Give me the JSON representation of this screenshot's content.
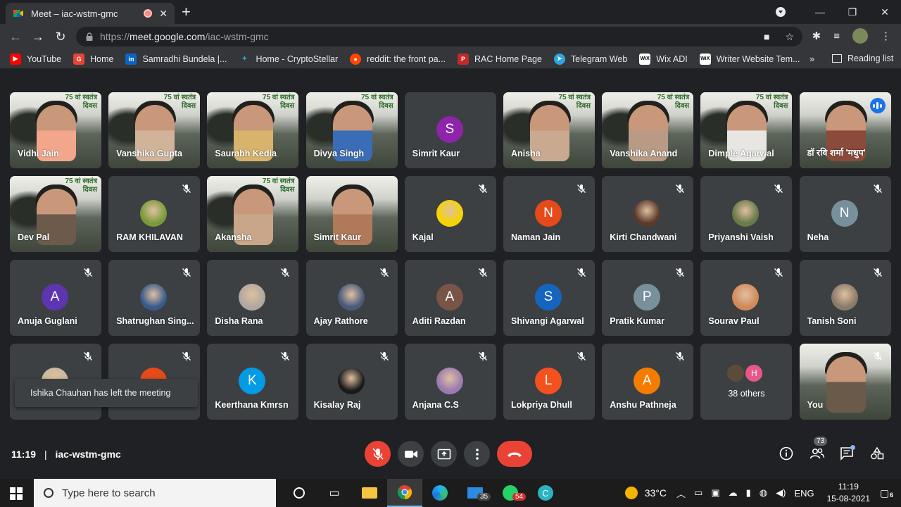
{
  "browser": {
    "tab_title": "Meet – iac-wstm-gmc",
    "url_prefix": "https://",
    "url_host": "meet.google.com",
    "url_path": "/iac-wstm-gmc"
  },
  "bookmarks": {
    "items": [
      {
        "label": "YouTube",
        "color": "#ff0000"
      },
      {
        "label": "Home",
        "color": "#ea4335"
      },
      {
        "label": "Samradhi Bundela |...",
        "color": "#0a66c2"
      },
      {
        "label": "Home - CryptoStellar",
        "color": "#2aa8d8"
      },
      {
        "label": "reddit: the front pa...",
        "color": "#ff4500"
      },
      {
        "label": "RAC Home Page",
        "color": "#c62828"
      },
      {
        "label": "Telegram Web",
        "color": "#2ca5e0"
      },
      {
        "label": "Wix ADI",
        "color": "#ffffff"
      },
      {
        "label": "Writer Website Tem...",
        "color": "#ffffff"
      }
    ],
    "more": "»",
    "reading_list": "Reading list"
  },
  "tiles": [
    {
      "name": "Vidhi Jain",
      "type": "video",
      "banner": "75 वां स्वतंत्र\nदिवस",
      "bg": "#f2a68a"
    },
    {
      "name": "Vanshika Gupta",
      "type": "video",
      "banner": "75 वां स्वतंत्र\nदिवस",
      "bg": "#d1b39a"
    },
    {
      "name": "Saurabh Kedia",
      "type": "video",
      "banner": "75 वां स्वतंत्र\nदिवस",
      "bg": "#d7b36b"
    },
    {
      "name": "Divya Singh",
      "type": "video",
      "banner": "75 वां स्वतंत्र\nदिवस",
      "bg": "#3a6db5"
    },
    {
      "name": "Simrit Kaur",
      "type": "avatar",
      "letter": "S",
      "color": "#8e24aa",
      "muted": false
    },
    {
      "name": "Anisha",
      "type": "video",
      "banner": "75 वां स्वतंत्र\nदिवस",
      "bg": "#c9a98f"
    },
    {
      "name": "Vanshika Anand",
      "type": "video",
      "banner": "75 वां स्वतंत्र\nदिवस",
      "bg": "#b99a84"
    },
    {
      "name": "Dimple Agarwal",
      "type": "video",
      "banner": "75 वां स्वतंत्र\nदिवस",
      "bg": "#e8e6e3"
    },
    {
      "name": "डॉ रवि शर्मा 'मधुप'",
      "type": "video",
      "banner": "",
      "bg": "#8b4a3a",
      "speaking": true
    },
    {
      "name": "Dev Pal",
      "type": "video",
      "banner": "75 वां स्वतंत्र\nदिवस",
      "bg": "#6c5a4a"
    },
    {
      "name": "RAM KHILAVAN",
      "type": "avatar",
      "letter": "",
      "color": "#7a9a3a",
      "photo": true,
      "muted": true
    },
    {
      "name": "Akansha",
      "type": "video",
      "banner": "75 वां स्वतंत्र\nदिवस",
      "bg": "#c9a58a"
    },
    {
      "name": "Simrit Kaur",
      "type": "video",
      "banner": "",
      "bg": "#b07a5a"
    },
    {
      "name": "Kajal",
      "type": "avatar",
      "letter": "",
      "color": "#f5d400",
      "photo": true,
      "muted": true
    },
    {
      "name": "Naman Jain",
      "type": "avatar",
      "letter": "N",
      "color": "#e64a19",
      "muted": true
    },
    {
      "name": "Kirti Chandwani",
      "type": "avatar",
      "letter": "",
      "color": "#5a3a2a",
      "photo": true,
      "muted": true
    },
    {
      "name": "Priyanshi Vaish",
      "type": "avatar",
      "letter": "",
      "color": "#6a7a4a",
      "photo": true,
      "muted": true
    },
    {
      "name": "Neha",
      "type": "avatar",
      "letter": "N",
      "color": "#78909c",
      "muted": true
    },
    {
      "name": "Anuja Guglani",
      "type": "avatar",
      "letter": "A",
      "color": "#5e35b1",
      "muted": true
    },
    {
      "name": "Shatrughan Sing...",
      "type": "avatar",
      "letter": "",
      "color": "#3a5a8a",
      "photo": true,
      "muted": true
    },
    {
      "name": "Disha Rana",
      "type": "avatar",
      "letter": "",
      "color": "#b0a8a0",
      "photo": true,
      "muted": true
    },
    {
      "name": "Ajay Rathore",
      "type": "avatar",
      "letter": "",
      "color": "#4a5a7a",
      "photo": true,
      "muted": true
    },
    {
      "name": "Aditi Razdan",
      "type": "avatar",
      "letter": "A",
      "color": "#795548",
      "muted": true
    },
    {
      "name": "Shivangi Agarwal",
      "type": "avatar",
      "letter": "S",
      "color": "#1565c0",
      "muted": true
    },
    {
      "name": "Pratik Kumar",
      "type": "avatar",
      "letter": "P",
      "color": "#78909c",
      "muted": true
    },
    {
      "name": "Sourav Paul",
      "type": "avatar",
      "letter": "",
      "color": "#d08a5a",
      "photo": true,
      "muted": true
    },
    {
      "name": "Tanish Soni",
      "type": "avatar",
      "letter": "",
      "color": "#8a7a6a",
      "photo": true,
      "muted": true
    },
    {
      "name": "",
      "type": "avatar",
      "letter": "",
      "color": "#c9b8a0",
      "photo": true,
      "muted": true
    },
    {
      "name": "",
      "type": "avatar",
      "letter": "",
      "color": "#e64a19",
      "muted": true
    },
    {
      "name": "Keerthana Kmrsn",
      "type": "avatar",
      "letter": "K",
      "color": "#039be5",
      "muted": true
    },
    {
      "name": "Kisalay Raj",
      "type": "avatar",
      "letter": "",
      "color": "#1a1a1a",
      "photo": true,
      "muted": true
    },
    {
      "name": "Anjana C.S",
      "type": "avatar",
      "letter": "",
      "color": "#9a7ab0",
      "photo": true,
      "muted": true
    },
    {
      "name": "Lokpriya Dhull",
      "type": "avatar",
      "letter": "L",
      "color": "#f4511e",
      "muted": true
    },
    {
      "name": "Anshu Pathneja",
      "type": "avatar",
      "letter": "A",
      "color": "#f57c00",
      "muted": true
    },
    {
      "name": "38 others",
      "type": "others",
      "letter": "H"
    },
    {
      "name": "You",
      "type": "video",
      "banner": "",
      "bg": "#6a5a4a",
      "muted": true
    }
  ],
  "toast": "Ishika Chauhan has left the meeting",
  "meet": {
    "time": "11:19",
    "separator": "|",
    "code": "iac-wstm-gmc",
    "people_count": "73"
  },
  "taskbar": {
    "search_placeholder": "Type here to search",
    "mail_count": "35",
    "whatsapp_count": "54",
    "temperature": "33°C",
    "language": "ENG",
    "time": "11:19",
    "date": "15-08-2021",
    "notifications": "6"
  }
}
